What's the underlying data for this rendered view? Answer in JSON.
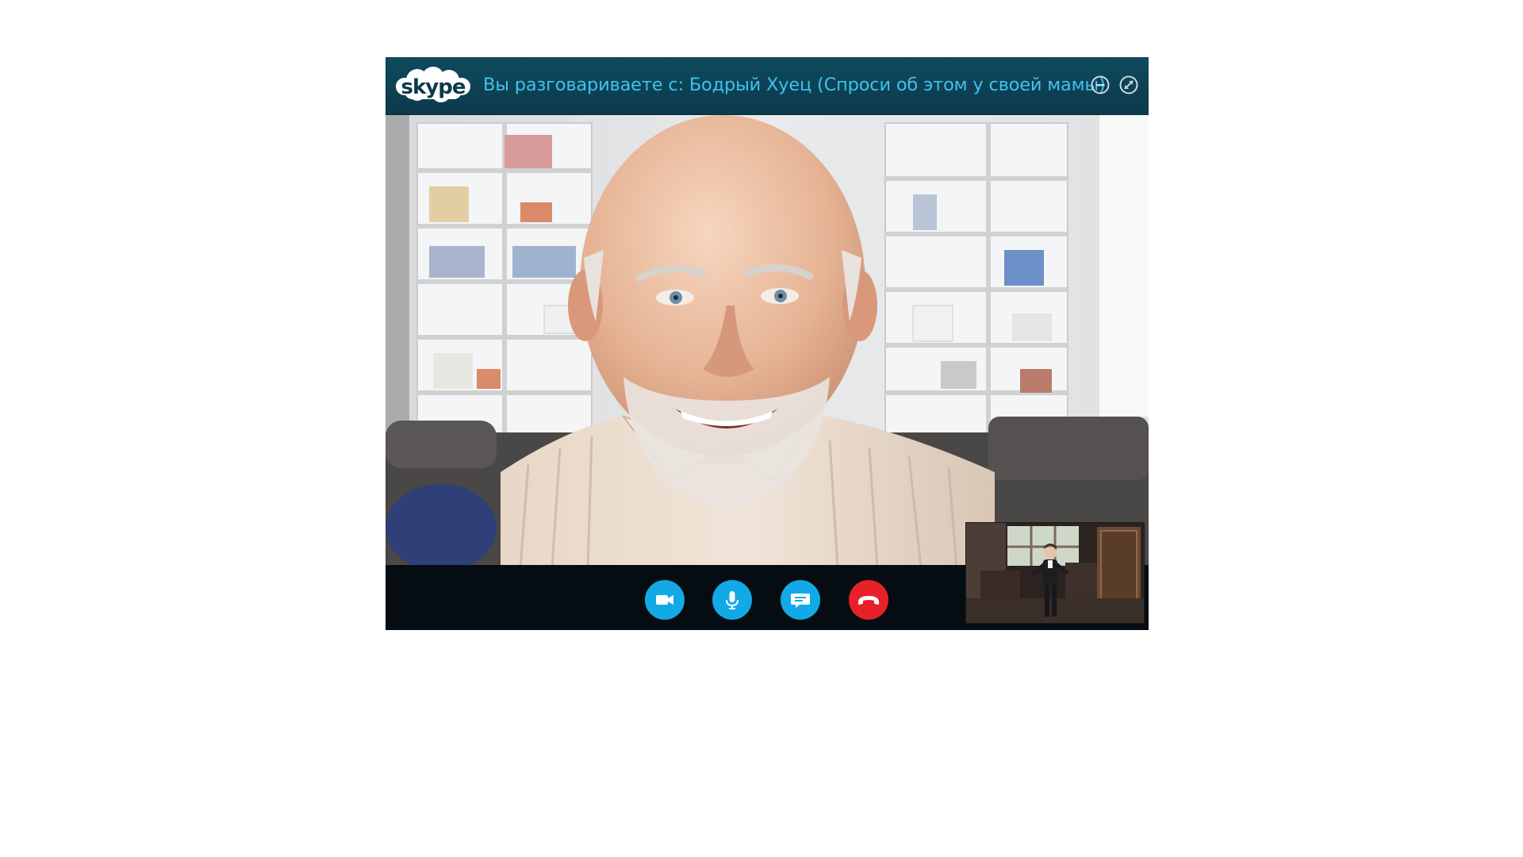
{
  "app": {
    "name": "skype",
    "logo_text": "skype",
    "title": "Вы разговариваете с: Бодрый Хуец (Спроси об этом у своей мамы)"
  },
  "window_controls": [
    {
      "name": "minimize",
      "icon": "minus-circle-icon"
    },
    {
      "name": "expand",
      "icon": "expand-arrows-icon"
    }
  ],
  "call_controls": [
    {
      "name": "video",
      "icon": "video-camera-icon"
    },
    {
      "name": "microphone",
      "icon": "microphone-icon"
    },
    {
      "name": "chat",
      "icon": "chat-bubble-icon"
    },
    {
      "name": "end-call",
      "icon": "hang-up-phone-icon"
    }
  ],
  "colors": {
    "title_bar": "#0b3a4b",
    "title_text": "#3fc2ee",
    "control_button": "#12aae6",
    "end_call_button": "#e7202a",
    "control_bar": "#060d12"
  }
}
